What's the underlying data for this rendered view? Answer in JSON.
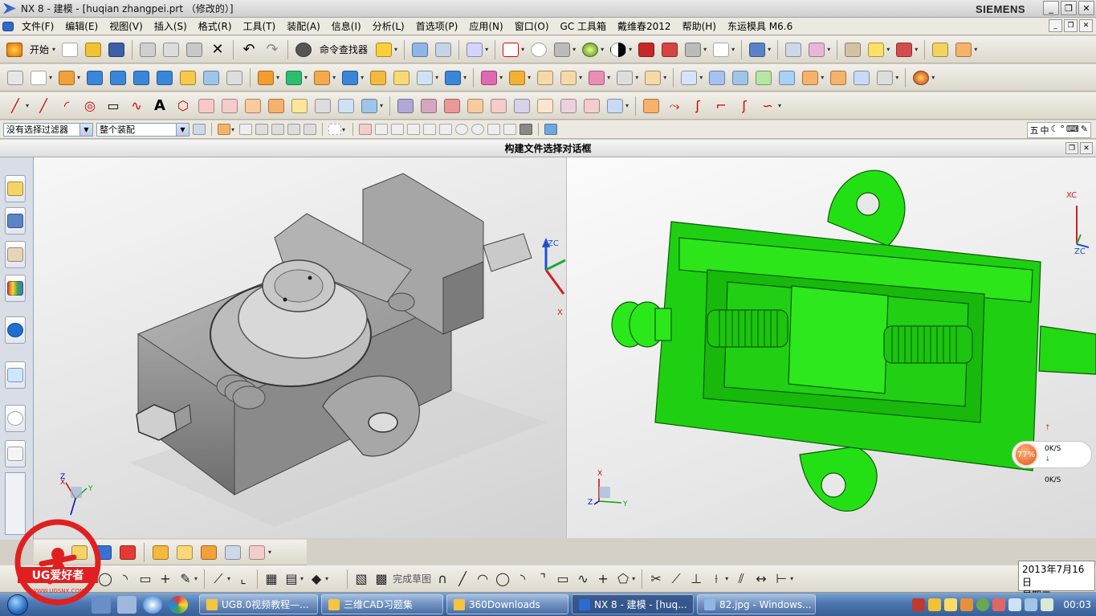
{
  "window": {
    "title": "NX 8 - 建模 - [huqian zhangpei.prt （修改的）]",
    "brand": "SIEMENS",
    "controls": [
      "_",
      "❐",
      "✕"
    ]
  },
  "menubar": {
    "items": [
      "文件(F)",
      "编辑(E)",
      "视图(V)",
      "插入(S)",
      "格式(R)",
      "工具(T)",
      "装配(A)",
      "信息(I)",
      "分析(L)",
      "首选项(P)",
      "应用(N)",
      "窗口(O)",
      "GC 工具箱",
      "戴维春2012",
      "帮助(H)",
      "东运模具 M6.6"
    ]
  },
  "toolbar1": {
    "start_label": "开始",
    "command_finder_label": "命令查找器"
  },
  "selection_bar": {
    "filter_value": "没有选择过滤器",
    "scope_value": "整个装配",
    "ime": [
      "五",
      "中",
      "☾",
      "°",
      "⌨",
      "✎"
    ]
  },
  "dialog": {
    "title": "构建文件选择对话框"
  },
  "viewports": {
    "left": {
      "triad": {
        "x": "X",
        "y": "Y",
        "z": "ZC"
      },
      "small_triad": {
        "x": "X",
        "y": "Y",
        "z": "Z"
      },
      "model_color": "#9a9a9a"
    },
    "right": {
      "triad": {
        "x": "XC",
        "y": "",
        "z": "ZC"
      },
      "small_triad": {
        "x": "X",
        "y": "Y",
        "z": "Z"
      },
      "model_color": "#22dd11"
    }
  },
  "bottom_toolbar": {
    "finish_sketch_label": "完成草图"
  },
  "net_widget": {
    "percent": "77%",
    "up": "0K/S",
    "down": "0K/S"
  },
  "taskbar": {
    "tasks": [
      {
        "label": "UG8.0视频教程—...",
        "icon": "folder-icon"
      },
      {
        "label": "三维CAD习题集",
        "icon": "folder-icon"
      },
      {
        "label": "360Downloads",
        "icon": "folder-icon"
      },
      {
        "label": "NX 8 - 建模 - [huq...",
        "icon": "nx-icon"
      },
      {
        "label": "82.jpg - Windows...",
        "icon": "image-viewer-icon"
      }
    ],
    "clock": "00:03"
  },
  "date_tooltip": {
    "date": "2013年7月16日",
    "weekday": "星期二"
  },
  "watermark": {
    "text": "UG爱好者",
    "url": "WWW.UGSNX.COM"
  }
}
